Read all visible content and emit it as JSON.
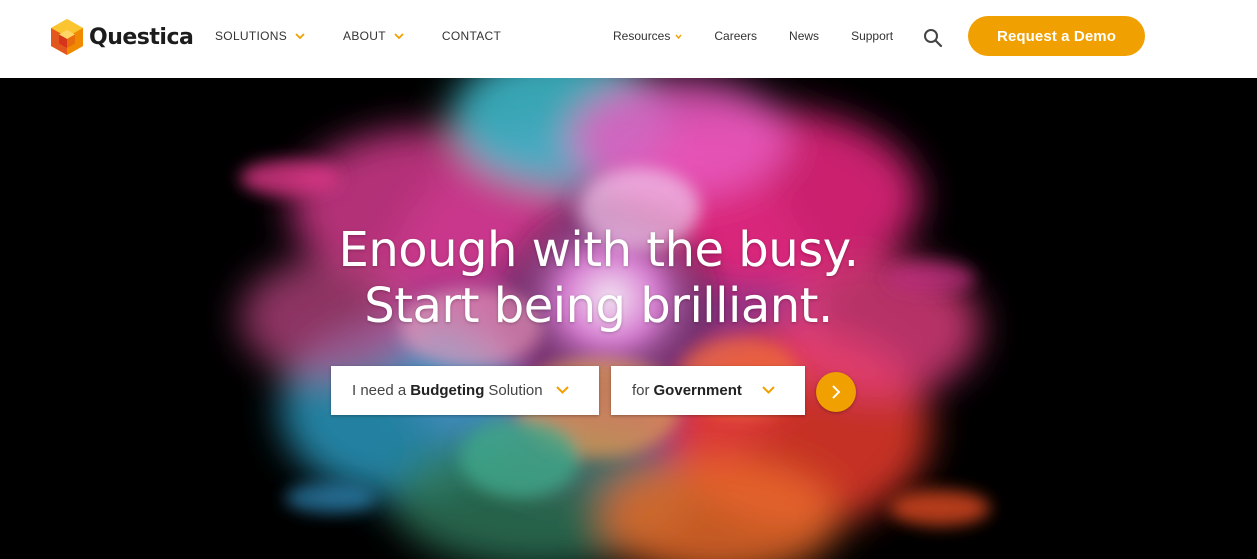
{
  "brand": {
    "name": "Questica",
    "accent_color": "#f0a000",
    "logo_icon": "hexagon-cube-icon"
  },
  "nav": {
    "primary": [
      {
        "label": "SOLUTIONS",
        "has_dropdown": true
      },
      {
        "label": "ABOUT",
        "has_dropdown": true
      },
      {
        "label": "CONTACT",
        "has_dropdown": false
      }
    ],
    "secondary": [
      {
        "label": "Resources",
        "has_dropdown": true
      },
      {
        "label": "Careers",
        "has_dropdown": false
      },
      {
        "label": "News",
        "has_dropdown": false
      },
      {
        "label": "Support",
        "has_dropdown": false
      }
    ],
    "search_icon": "search-icon",
    "cta_label": "Request a Demo"
  },
  "hero": {
    "headline_line1": "Enough with the busy.",
    "headline_line2": "Start being brilliant.",
    "selector1": {
      "prefix": "I need a",
      "value": "Budgeting",
      "suffix": "Solution"
    },
    "selector2": {
      "prefix": "for",
      "value": "Government"
    },
    "go_icon": "chevron-right-icon"
  }
}
